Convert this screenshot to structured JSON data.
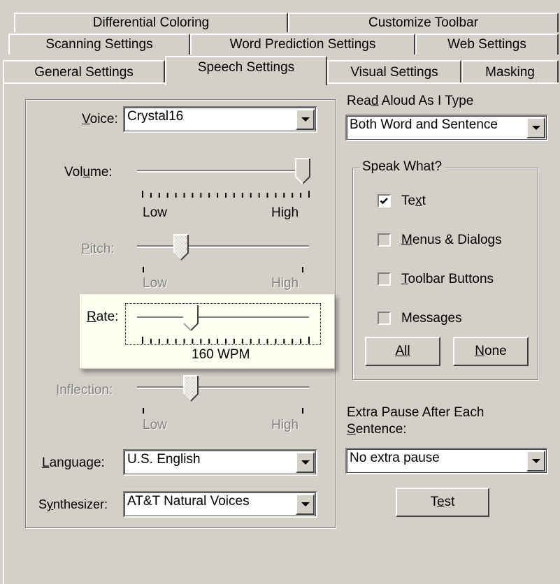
{
  "tabs": {
    "row1": [
      "Differential Coloring",
      "Customize Toolbar"
    ],
    "row2": [
      "Scanning Settings",
      "Word Prediction Settings",
      "Web Settings"
    ],
    "row3": [
      "General Settings",
      "Speech Settings",
      "Visual Settings",
      "Masking"
    ]
  },
  "voice": {
    "label": "Voice:",
    "value": "Crystal16"
  },
  "volume": {
    "label": "Volume:",
    "low": "Low",
    "high": "High",
    "level": 1.0
  },
  "pitch": {
    "label": "Pitch:",
    "low": "Low",
    "high": "High",
    "level": 0.25,
    "enabled": false
  },
  "rate": {
    "label": "Rate:",
    "value_text": "160 WPM",
    "level": 0.33
  },
  "inflection": {
    "label": "Inflection:",
    "low": "Low",
    "high": "High",
    "level": 0.33,
    "enabled": false
  },
  "language": {
    "label": "Language:",
    "value": "U.S. English"
  },
  "synthesizer": {
    "label": "Synthesizer:",
    "value": "AT&T Natural Voices"
  },
  "read_aloud": {
    "label": "Read Aloud As I Type",
    "value": "Both Word and Sentence"
  },
  "speak_what": {
    "title": "Speak What?",
    "items": [
      {
        "label": "Text",
        "checked": true
      },
      {
        "label": "Menus & Dialogs",
        "checked": false
      },
      {
        "label": "Toolbar Buttons",
        "checked": false
      },
      {
        "label": "Messages",
        "checked": false
      }
    ],
    "all_label": "All",
    "none_label": "None"
  },
  "extra_pause": {
    "label_line1": "Extra Pause After Each",
    "label_line2": "Sentence:",
    "value": "No extra pause"
  },
  "test_label": "Test",
  "colors": {
    "face": "#d4d0c8",
    "highlight": "#fffff2",
    "disabled": "#808080"
  }
}
